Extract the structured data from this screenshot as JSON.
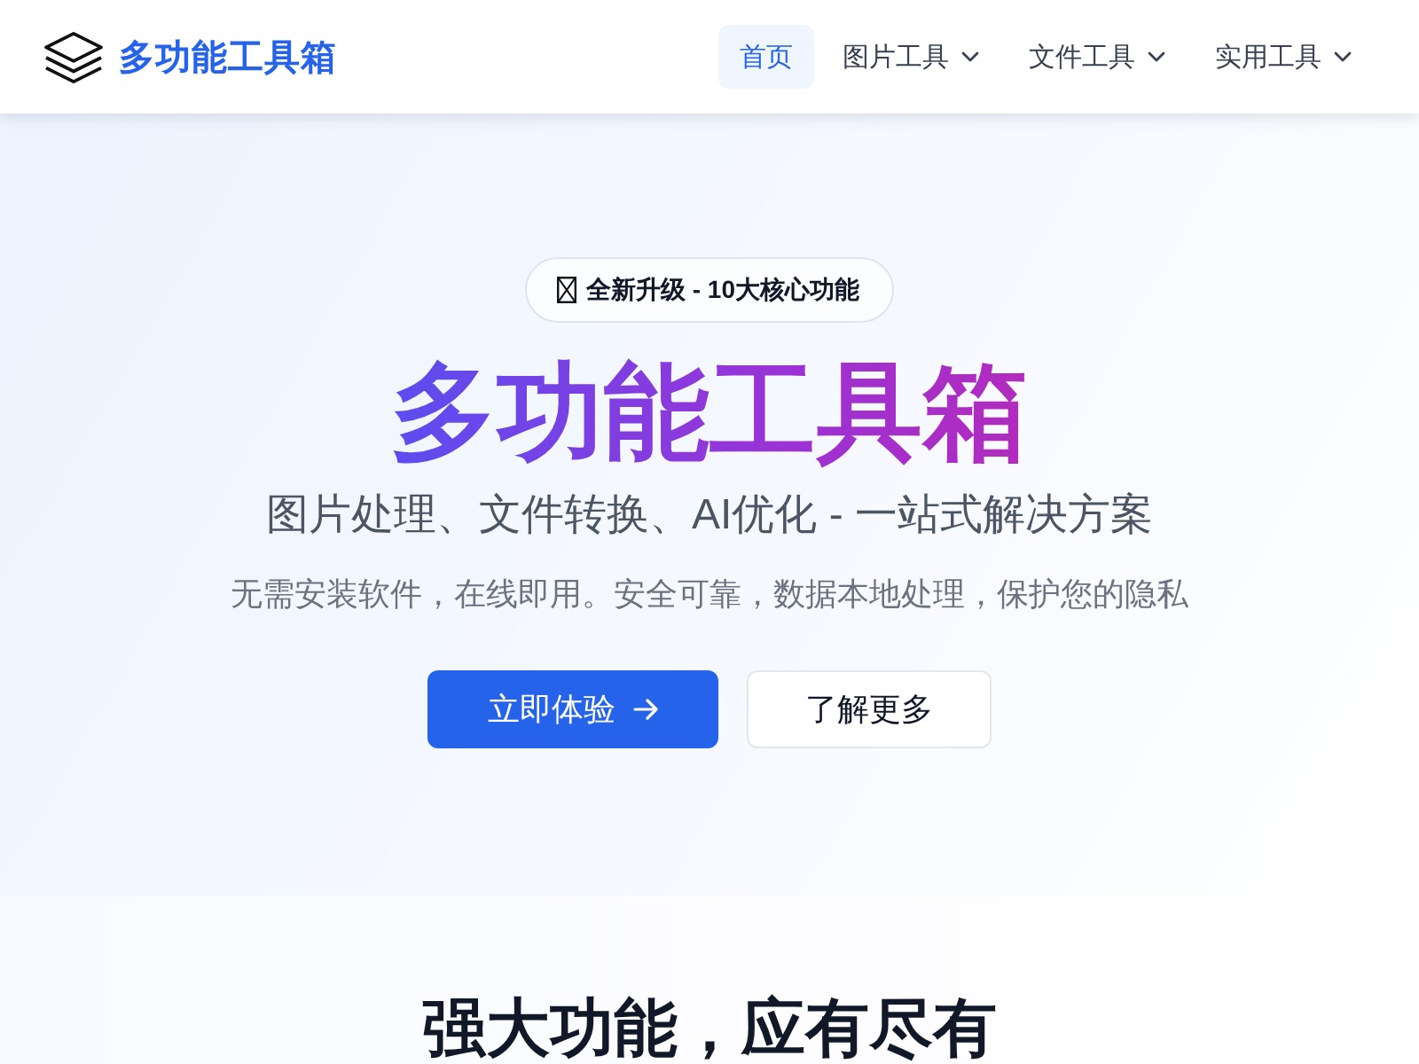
{
  "header": {
    "logo_text": "多功能工具箱",
    "nav": [
      {
        "label": "首页",
        "selected": true,
        "dropdown": false
      },
      {
        "label": "图片工具",
        "selected": false,
        "dropdown": true
      },
      {
        "label": "文件工具",
        "selected": false,
        "dropdown": true
      },
      {
        "label": "实用工具",
        "selected": false,
        "dropdown": true
      }
    ]
  },
  "hero": {
    "badge": "全新升级 - 10大核心功能",
    "title": "多功能工具箱",
    "subtitle": "图片处理、文件转换、AI优化 - 一站式解决方案",
    "description": "无需安装软件，在线即用。安全可靠，数据本地处理，保护您的隐私",
    "buttons": [
      {
        "label": "立即体验",
        "kind": "primary"
      },
      {
        "label": "了解更多",
        "kind": "secondary"
      }
    ]
  },
  "features": {
    "heading": "强大功能，应有尽有"
  }
}
